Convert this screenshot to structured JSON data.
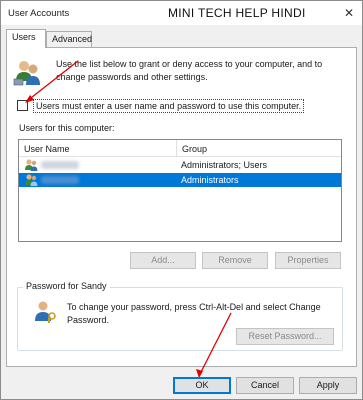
{
  "window": {
    "title": "User Accounts",
    "close_glyph": "✕"
  },
  "watermark": "MINI TECH HELP HINDI",
  "tabs": [
    {
      "label": "Users",
      "active": true
    },
    {
      "label": "Advanced",
      "active": false
    }
  ],
  "intro": {
    "text": "Use the list below to grant or deny access to your computer, and to change passwords and other settings.",
    "icon": "users-group-icon"
  },
  "require_login": {
    "label": "Users must enter a user name and password to use this computer.",
    "checked": false
  },
  "users_list": {
    "label": "Users for this computer:",
    "columns": [
      "User Name",
      "Group"
    ],
    "rows": [
      {
        "group": "Administrators; Users",
        "selected": false
      },
      {
        "group": "Administrators",
        "selected": true
      }
    ]
  },
  "list_buttons": {
    "add": "Add...",
    "remove": "Remove",
    "properties": "Properties"
  },
  "password_box": {
    "legend": "Password for Sandy",
    "text": "To change your password, press Ctrl-Alt-Del and select Change Password.",
    "reset": "Reset Password...",
    "icon": "user-key-icon"
  },
  "dialog_buttons": {
    "ok": "OK",
    "cancel": "Cancel",
    "apply": "Apply"
  },
  "colors": {
    "selection": "#0078d7",
    "annotation_arrow": "#e00000"
  }
}
